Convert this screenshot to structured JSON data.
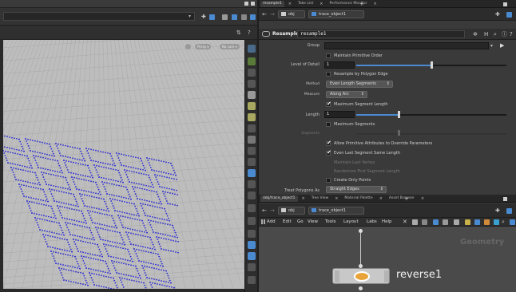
{
  "colors": {
    "accent": "#4a8ad0",
    "curve": "#2b2bd6",
    "viewport_bg": "#bdbdbd",
    "panel_bg": "#3a3a3a",
    "network_bg": "#4a4a4a"
  },
  "viewport": {
    "pill_left": "Persp ▾",
    "pill_right": "No cam ▾"
  },
  "param_tabs": [
    {
      "label": "resample1",
      "active": true
    },
    {
      "label": "Take List",
      "active": false
    },
    {
      "label": "Performance Monitor",
      "active": false
    }
  ],
  "path_top": {
    "context": "obj",
    "node": "trace_object1"
  },
  "param_header": {
    "type": "Resample",
    "name": "resample1"
  },
  "params": {
    "group_label": "Group",
    "maintain_prim_order": "Maintain Primitive Order",
    "level_of_detail_label": "Level of Detail",
    "level_of_detail_value": "1",
    "level_of_detail_fraction": 0.5,
    "resample_by_polygon_edge": "Resample by Polygon Edge",
    "method_label": "Method",
    "method_value": "Even Length Segments",
    "measure_label": "Measure",
    "measure_value": "Along Arc",
    "max_segment_length": "Maximum Segment Length",
    "length_label": "Length",
    "length_value": "1",
    "length_fraction": 0.28,
    "max_segments": "Maximum Segments",
    "segments_label": "Segments",
    "segments_fraction": 0.28,
    "allow_prim_attrs": "Allow Primitive Attributes to Override Parameters",
    "even_last_segment": "Even Last Segment Same Length",
    "maintain_last_vertex": "Maintain Last Vertex",
    "randomize_first_segment": "Randomize First Segment Length",
    "create_only_points": "Create Only Points",
    "treat_polygons_label": "Treat Polygons As",
    "treat_polygons_value": "Straight Edges"
  },
  "network_tabs": [
    {
      "label": "/obj/trace_object1",
      "active": true
    },
    {
      "label": "Tree View",
      "active": false
    },
    {
      "label": "Material Palette",
      "active": false
    },
    {
      "label": "Asset Browser",
      "active": false
    }
  ],
  "path_bottom": {
    "context": "obj",
    "node": "trace_object1"
  },
  "network_menu": [
    "Add",
    "Edit",
    "Go",
    "View",
    "Tools",
    "Layout",
    "Labs",
    "Help"
  ],
  "network": {
    "context_label": "Geometry",
    "node_name": "reverse1"
  }
}
